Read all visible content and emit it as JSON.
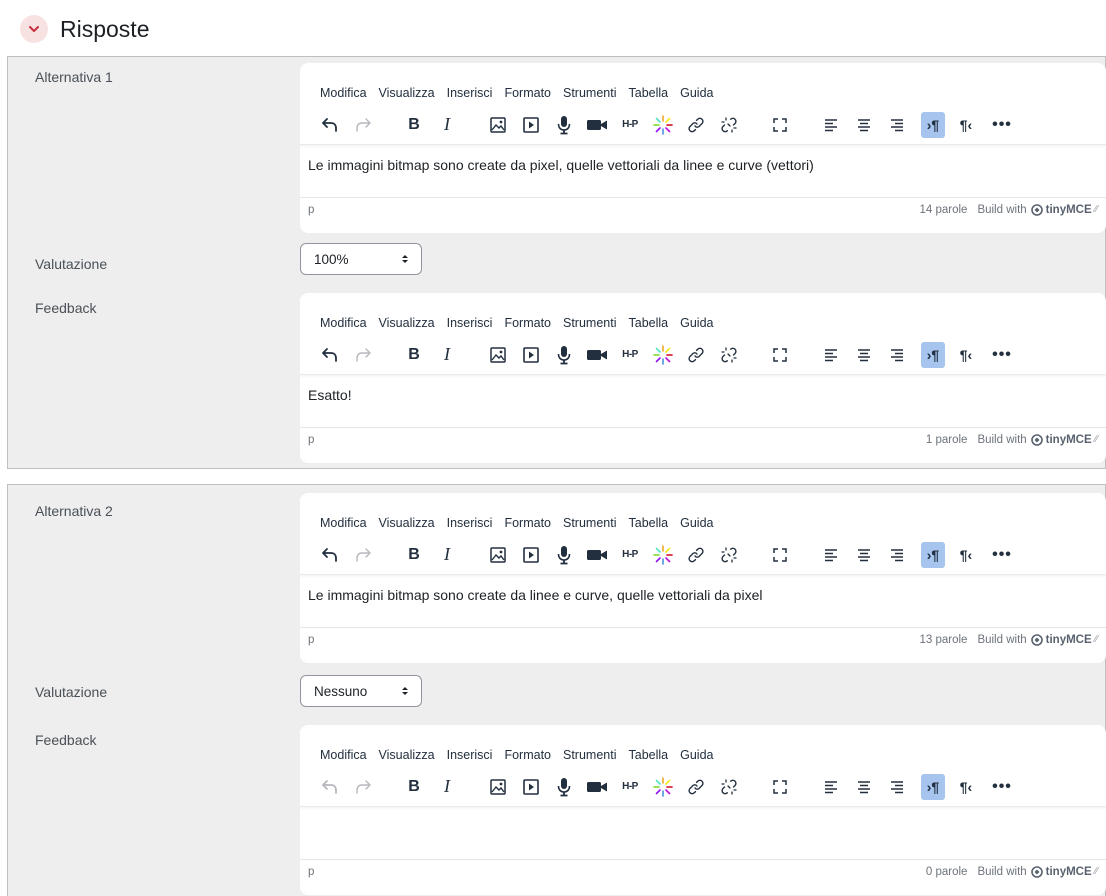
{
  "section": {
    "title": "Risposte"
  },
  "editor_menu": [
    "Modifica",
    "Visualizza",
    "Inserisci",
    "Formato",
    "Strumenti",
    "Tabella",
    "Guida"
  ],
  "editor_footer": {
    "path": "p",
    "build_with": "Build with",
    "brand": "tinyMCE"
  },
  "answers": [
    {
      "label": "Alternativa 1",
      "text": "Le immagini bitmap sono create da pixel, quelle vettoriali da linee e curve (vettori)",
      "word_count": "14 parole",
      "grade_label": "Valutazione",
      "grade_value": "100%",
      "feedback_label": "Feedback",
      "feedback_text": "Esatto!",
      "feedback_word_count": "1 parole"
    },
    {
      "label": "Alternativa 2",
      "text": "Le immagini bitmap sono create da linee e curve, quelle vettoriali da pixel",
      "word_count": "13 parole",
      "grade_label": "Valutazione",
      "grade_value": "Nessuno",
      "feedback_label": "Feedback",
      "feedback_text": "",
      "feedback_word_count": "0 parole"
    }
  ],
  "colors": {
    "panel_bg": "#eeeeee",
    "active_button": "#a6c4ee",
    "collapse_bg": "#f8e1e1",
    "collapse_icon": "#c8303f"
  }
}
